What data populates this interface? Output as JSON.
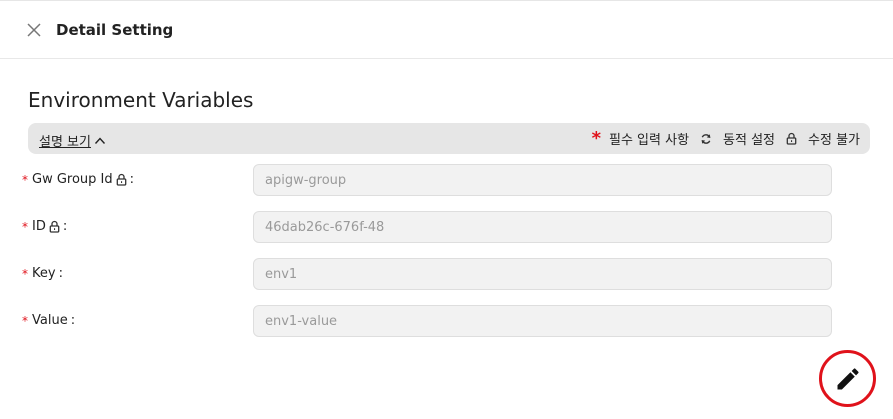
{
  "header": {
    "close_icon": "close-icon",
    "title": "Detail Setting"
  },
  "section": {
    "title": "Environment Variables"
  },
  "legend": {
    "toggle_label": "설명 보기",
    "toggle_icon": "chevron-up-icon",
    "required_symbol": "*",
    "required_label": "필수 입력 사항",
    "dynamic_icon": "refresh-icon",
    "dynamic_label": "동적 설정",
    "locked_icon": "lock-icon",
    "locked_label": "수정 불가"
  },
  "fields": [
    {
      "required": "*",
      "label": "Gw Group Id",
      "locked": true,
      "colon": ":",
      "value": "apigw-group"
    },
    {
      "required": "*",
      "label": "ID",
      "locked": true,
      "colon": ":",
      "value": "46dab26c-676f-48"
    },
    {
      "required": "*",
      "label": "Key",
      "locked": false,
      "colon": ":",
      "value": "env1"
    },
    {
      "required": "*",
      "label": "Value",
      "locked": false,
      "colon": ":",
      "value": "env1-value"
    }
  ],
  "fab": {
    "icon": "pencil-icon",
    "accent_color": "#e0121b"
  },
  "colors": {
    "required_star": "#e0121b",
    "input_bg": "#f2f2f2",
    "legend_bg": "#e6e6e6"
  }
}
